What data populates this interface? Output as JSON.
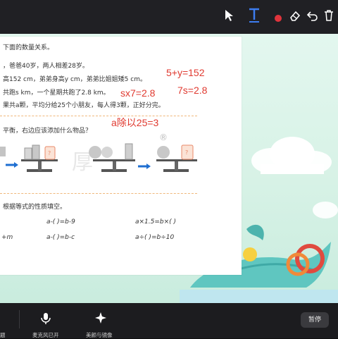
{
  "toolbar": {
    "tools": [
      "pointer-tool",
      "text-tool",
      "color-tool",
      "eraser-tool",
      "undo-tool",
      "delete-tool",
      "camera-tool"
    ]
  },
  "doc": {
    "intro": "下面的数量关系。",
    "line1": "，爸爸40岁，两人相差28岁。",
    "line2": "高152 cm，弟弟身高y cm，弟弟比姐姐矮5 cm。",
    "line3": "共跑s km，一个星期共跑了2.8 km。",
    "line4": "果共a颗，平均分给25个小朋友，每人得3颗，正好分完。",
    "balance_prompt": "平衡，右边应该添加什么物品？",
    "fill_prompt": "根据等式的性质填空。",
    "eq": {
      "r1c1": "a-(     )=b-9",
      "r1c2": "a×1.5=b×(     )",
      "r2c0": "+m",
      "r2c1": "a-(     )=b-c",
      "r2c2": "a÷(     )=b÷10"
    },
    "watermark_mark": "®"
  },
  "annotations": {
    "a1": "5+y=152",
    "a2": "sx7=2.8",
    "a3": "7s=2.8",
    "a4": "a除以25=3"
  },
  "bottom": {
    "left_label": "题",
    "mic_label": "麦克风已开",
    "beauty_label": "美颜与镜像",
    "pause_label": "暂停"
  },
  "colors": {
    "ink": "#e03a30",
    "accent_blue": "#2b6fd6",
    "pause_bg": "#3a3a3e"
  }
}
